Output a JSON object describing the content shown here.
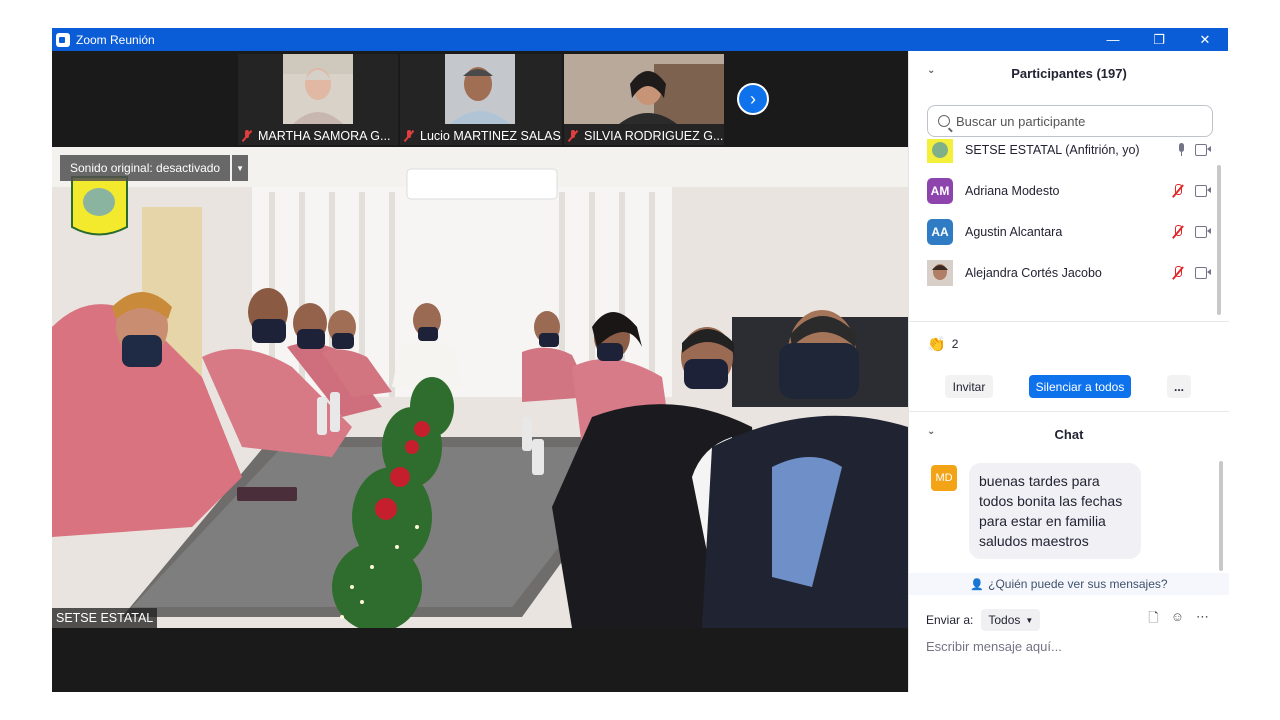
{
  "window": {
    "title": "Zoom Reunión",
    "minimize": "—",
    "restore": "❐",
    "close": "✕"
  },
  "thumbnails": [
    {
      "name": "MARTHA SAMORA G..."
    },
    {
      "name": "Lucio MARTINEZ SALAS"
    },
    {
      "name": "SILVIA RODRIGUEZ G..."
    }
  ],
  "main_video": {
    "sound_toggle": "Sonido original: desactivado",
    "speaker": "SETSE ESTATAL"
  },
  "participants": {
    "header": "Participantes (197)",
    "search_placeholder": "Buscar un participante",
    "list": [
      {
        "initials": "",
        "name": "SETSE ESTATAL (Anfitrión, yo)",
        "color": "#c9d33a",
        "mic": "on"
      },
      {
        "initials": "AM",
        "name": "Adriana Modesto",
        "color": "#8e44ad",
        "mic": "muted"
      },
      {
        "initials": "AA",
        "name": "Agustin Alcantara",
        "color": "#2f7bc4",
        "mic": "muted"
      },
      {
        "initials": "",
        "name": "Alejandra Cortés Jacobo",
        "color": "#9a7a66",
        "mic": "muted"
      }
    ],
    "reaction_count": "2",
    "invite": "Invitar",
    "mute_all": "Silenciar a todos",
    "more": "..."
  },
  "chat": {
    "header": "Chat",
    "messages": [
      {
        "initials": "MD",
        "text": "buenas tardes para todos bonita las fechas para estar en familia saludos maestros",
        "color": "#f2a416"
      }
    ],
    "who_can_see": "¿Quién puede ver sus mensajes?",
    "send_to_label": "Enviar a:",
    "recipient": "Todos",
    "input_placeholder": "Escribir mensaje aquí..."
  },
  "colors": {
    "titlebar": "#0b5cd7",
    "accent": "#0e72ed",
    "muted_red": "#e02828"
  }
}
